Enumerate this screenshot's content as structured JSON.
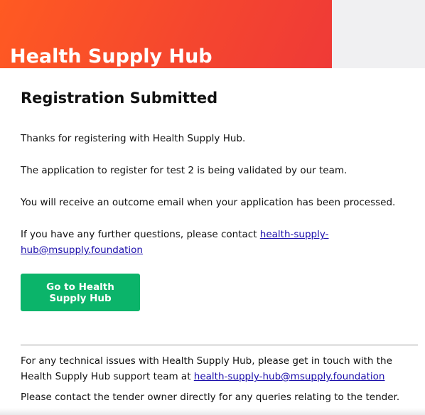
{
  "banner": {
    "title": "Health Supply Hub"
  },
  "main": {
    "heading": "Registration Submitted",
    "p1": "Thanks for registering with Health Supply Hub.",
    "p2": "The application to register for test 2 is being validated by our team.",
    "p3": "You will receive an outcome email when your application has been processed.",
    "p4_prefix": "If you have any further questions, please contact ",
    "p4_link": "health-supply-hub@msupply.foundation",
    "cta_label": "Go to Health Supply Hub"
  },
  "footer": {
    "p1_prefix": "For any technical issues with Health Supply Hub, please get in touch with the Health Supply Hub support team at ",
    "p1_link": "health-supply-hub@msupply.foundation",
    "p2": "Please contact the tender owner directly for any queries relating to the tender."
  },
  "colors": {
    "banner_start": "#ff5a22",
    "banner_end": "#ef3a37",
    "button": "#0bb46a",
    "link": "#1a0dab"
  }
}
